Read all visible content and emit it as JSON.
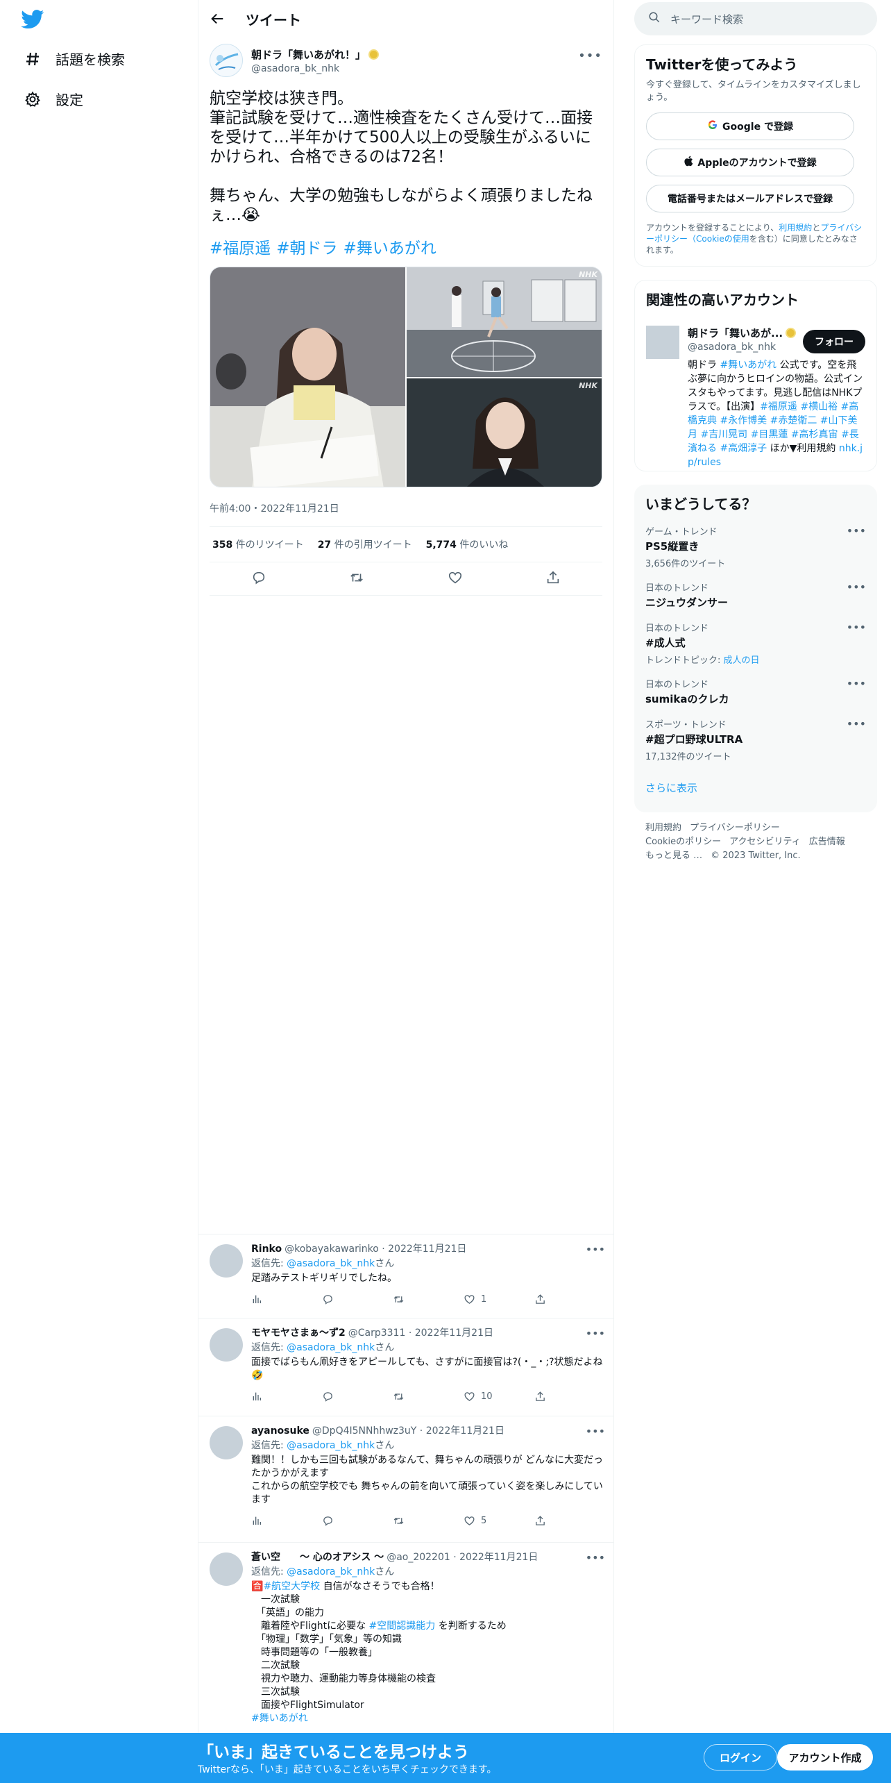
{
  "nav": {
    "explore_label": "話題を検索",
    "settings_label": "設定"
  },
  "header": {
    "title": "ツイート"
  },
  "tweet": {
    "author_name": "朝ドラ「舞いあがれ！」",
    "author_handle": "@asadora_bk_nhk",
    "avatar_text": "舞いあがれ",
    "text": "航空学校は狭き門。\n筆記試験を受けて…適性検査をたくさん受けて…面接を受けて…半年かけて500人以上の受験生がふるいにかけられ、合格できるのは72名！\n\n舞ちゃん、大学の勉強もしながらよく頑張りましたねぇ…😭",
    "hashtags": [
      "#福原遥",
      "#朝ドラ",
      "#舞いあがれ"
    ],
    "media_watermark": "NHK",
    "timestamp": "午前4:00・2022年11月21日",
    "stats": {
      "retweets_num": "358",
      "retweets_lbl": "件のリツイート",
      "quotes_num": "27",
      "quotes_lbl": "件の引用ツイート",
      "likes_num": "5,774",
      "likes_lbl": "件のいいね"
    }
  },
  "replies": [
    {
      "name": "Rinko",
      "meta": "@kobayakawarinko · 2022年11月21日",
      "to_prefix": "返信先: ",
      "to_handle": "@asadora_bk_nhk",
      "to_suffix": "さん",
      "text": "足踏みテストギリギリでしたね。",
      "likes": "1"
    },
    {
      "name": "モヤモヤさまぁ～ず2",
      "meta": "@Carp3311 · 2022年11月21日",
      "to_prefix": "返信先: ",
      "to_handle": "@asadora_bk_nhk",
      "to_suffix": "さん",
      "text": "面接でばらもん凧好きをアピールしても、さすがに面接官は?(・_・;?状態だよね🤣",
      "likes": "10"
    },
    {
      "name": "ayanosuke",
      "meta": "@DpQ4I5NNhhwz3uY · 2022年11月21日",
      "to_prefix": "返信先: ",
      "to_handle": "@asadora_bk_nhk",
      "to_suffix": "さん",
      "text": "難関！！しかも三回も試験があるなんて、舞ちゃんの頑張りが どんなに大変だったかうかがえます\nこれからの航空学校でも 舞ちゃんの前を向いて頑張っていく姿を楽しみにしています",
      "likes": "5"
    },
    {
      "name": "蒼い空　　～ 心のオアシス ～",
      "meta": "@ao_202201 · 2022年11月21日",
      "to_prefix": "返信先: ",
      "to_handle": "@asadora_bk_nhk",
      "to_suffix": "さん",
      "text_pre": "🈴",
      "text_tag1": "#航空大学校",
      "text_mid": " 自信がなさそうでも合格！\n　一次試験\n　「英語」の能力\n　離着陸やFlightに必要な ",
      "text_tag2": "#空間認識能力",
      "text_rest": " を判断するため\n　「物理」「数学」「気象」等の知識\n　時事問題等の「一般教養」\n　二次試験\n　視力や聴力、運動能力等身体機能の検査\n　三次試験\n　面接やFlightSimulator",
      "text_tag3": "#舞いあがれ"
    }
  ],
  "search": {
    "placeholder": "キーワード検索"
  },
  "signup": {
    "title": "Twitterを使ってみよう",
    "subtitle": "今すぐ登録して、タイムラインをカスタマイズしましょう。",
    "google": "Google で登録",
    "apple": "Appleのアカウントで登録",
    "phone": "電話番号またはメールアドレスで登録",
    "terms_pre": "アカウントを登録することにより、",
    "terms_link1": "利用規約",
    "terms_and": "と",
    "terms_link2": "プライバシーポリシー（Cookieの使用",
    "terms_post": "を含む）に同意したとみなされます。"
  },
  "related": {
    "title": "関連性の高いアカウント",
    "name": "朝ドラ「舞いあが...",
    "handle": "@asadora_bk_nhk",
    "follow": "フォロー",
    "bio_a": "朝ドラ ",
    "bio_tag": "#舞いあがれ",
    "bio_b": " 公式です。空を飛ぶ夢に向かうヒロインの物語。公式インスタもやってます。見逃し配信はNHKプラスで。【出演】",
    "bio_cast": "#福原遥 #横山裕 #高橋克典 #永作博美 #赤楚衛二 #山下美月 #吉川晃司 #目黒蓮 #高杉真宙 #長濱ねる #高畑淳子",
    "bio_c": " ほか▼利用規約 ",
    "bio_link": "nhk.jp/rules"
  },
  "trends": {
    "title": "いまどうしてる？",
    "items": [
      {
        "meta": "ゲーム・トレンド",
        "name": "PS5縦置き",
        "count": "3,656件のツイート"
      },
      {
        "meta": "日本のトレンド",
        "name": "ニジュウダンサー",
        "count": ""
      },
      {
        "meta": "日本のトレンド",
        "name": "#成人式",
        "count": "トレンドトピック: ",
        "topic": "成人の日"
      },
      {
        "meta": "日本のトレンド",
        "name": "sumikaのクレカ",
        "count": ""
      },
      {
        "meta": "スポーツ・トレンド",
        "name": "#超プロ野球ULTRA",
        "count": "17,132件のツイート"
      }
    ],
    "show_more": "さらに表示"
  },
  "footer": {
    "terms": "利用規約",
    "privacy": "プライバシーポリシー",
    "cookie": "Cookieのポリシー",
    "accessibility": "アクセシビリティ",
    "ads": "広告情報",
    "more": "もっと見る …",
    "copyright": "© 2023 Twitter, Inc."
  },
  "bottombar": {
    "title": "「いま」起きていることを見つけよう",
    "subtitle": "Twitterなら、「いま」起きていることをいち早くチェックできます。",
    "login": "ログイン",
    "register": "アカウント作成"
  },
  "colors": {
    "accent": "#1d9bf0",
    "text": "#0f1419",
    "secondary": "#536471"
  }
}
